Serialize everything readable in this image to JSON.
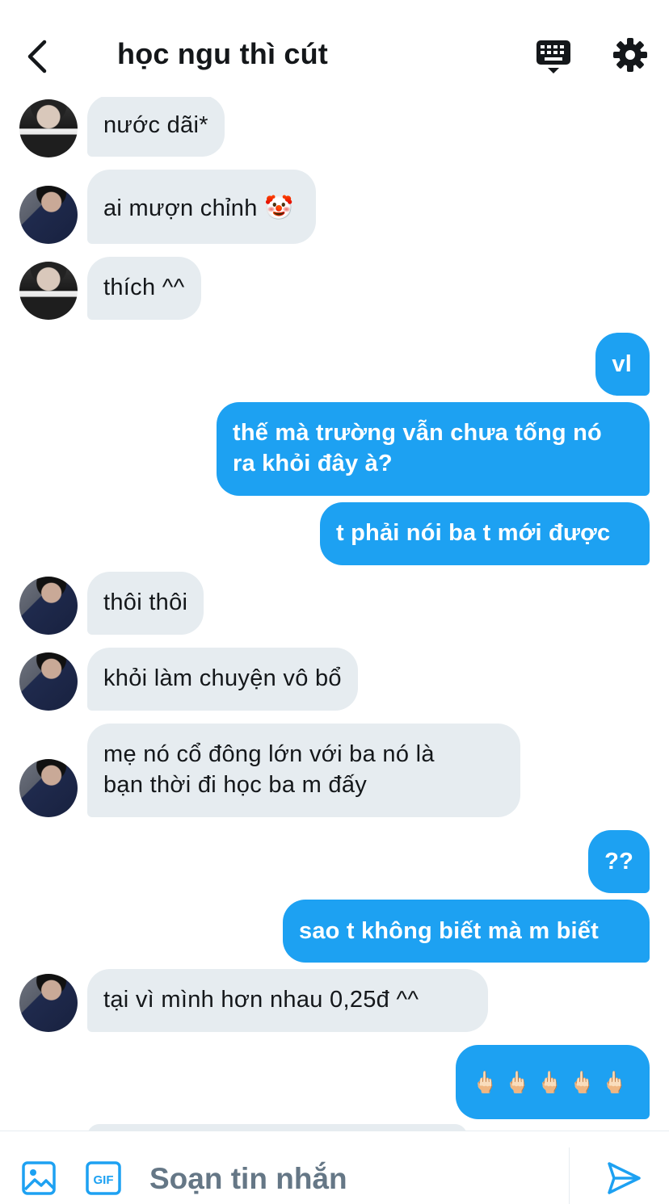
{
  "header": {
    "title": "học ngu thì cút",
    "back_icon": "chevron-left-icon",
    "keyboard_icon": "keyboard-icon",
    "settings_icon": "gear-icon"
  },
  "messages": [
    {
      "side": "in",
      "avatar": "a1",
      "text": "nước dãi*"
    },
    {
      "side": "in",
      "avatar": "a2",
      "text": "ai mượn chỉnh 🤡"
    },
    {
      "side": "in",
      "avatar": "a1",
      "text": "thích ^^"
    },
    {
      "side": "out",
      "text": "vl"
    },
    {
      "side": "out",
      "text": "thế mà trường vẫn chưa tống nó\nra khỏi đây à?"
    },
    {
      "side": "out",
      "text": "t phải nói ba t mới được"
    },
    {
      "side": "in",
      "avatar": "a2",
      "text": "thôi thôi"
    },
    {
      "side": "in",
      "avatar": "a2",
      "text": "khỏi làm chuyện vô bổ"
    },
    {
      "side": "in",
      "avatar": "a2",
      "text": "mẹ nó cổ đông lớn với ba nó là\nbạn thời đi học ba m đấy"
    },
    {
      "side": "out",
      "text": "??"
    },
    {
      "side": "out",
      "text": "sao t không biết mà m biết"
    },
    {
      "side": "in",
      "avatar": "a2",
      "text": "tại vì mình hơn nhau 0,25đ ^^"
    },
    {
      "side": "out",
      "text": "🖕🏻 🖕🏻 🖕🏻 🖕🏻 🖕🏻"
    }
  ],
  "composer": {
    "placeholder": "Soạn tin nhắn",
    "image_icon": "image-icon",
    "gif_label": "GIF",
    "send_icon": "send-icon"
  },
  "colors": {
    "accent": "#1da1f2",
    "incoming_bubble": "#e6ecf0",
    "placeholder": "#657786",
    "text": "#14171a"
  }
}
